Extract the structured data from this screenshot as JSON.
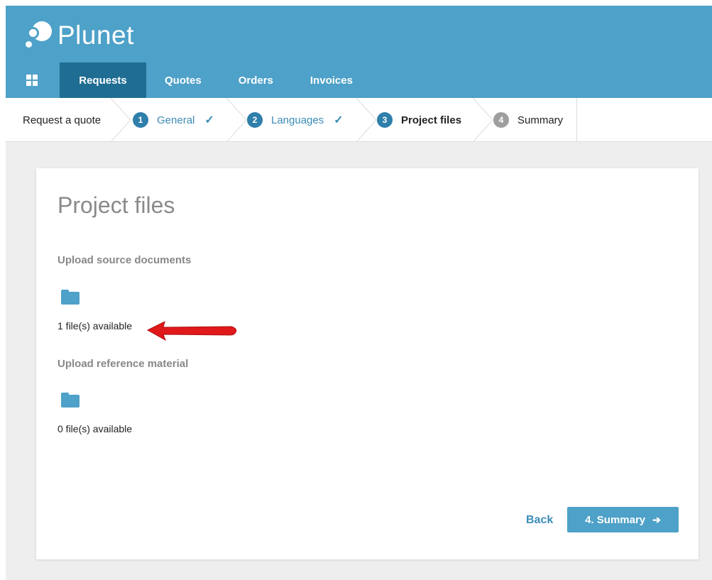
{
  "app": {
    "name": "Plunet"
  },
  "nav": {
    "items": [
      {
        "label": "Requests",
        "active": true
      },
      {
        "label": "Quotes",
        "active": false
      },
      {
        "label": "Orders",
        "active": false
      },
      {
        "label": "Invoices",
        "active": false
      }
    ]
  },
  "breadcrumb": {
    "root": "Request a quote",
    "steps": [
      {
        "number": "1",
        "label": "General",
        "status": "done"
      },
      {
        "number": "2",
        "label": "Languages",
        "status": "done"
      },
      {
        "number": "3",
        "label": "Project files",
        "status": "current"
      },
      {
        "number": "4",
        "label": "Summary",
        "status": "pending"
      }
    ],
    "check_glyph": "✓"
  },
  "main": {
    "title": "Project files",
    "source": {
      "label": "Upload source documents",
      "count_text": "1 file(s) available",
      "icon": "folder-icon"
    },
    "reference": {
      "label": "Upload reference material",
      "count_text": "0 file(s) available",
      "icon": "folder-icon"
    },
    "back_label": "Back",
    "next_label": "4. Summary",
    "next_arrow": "➔"
  },
  "colors": {
    "header": "#4ea1c8",
    "nav_active": "#1f6d92",
    "accent": "#3b8cb8",
    "annotation_arrow": "#e0191b"
  }
}
